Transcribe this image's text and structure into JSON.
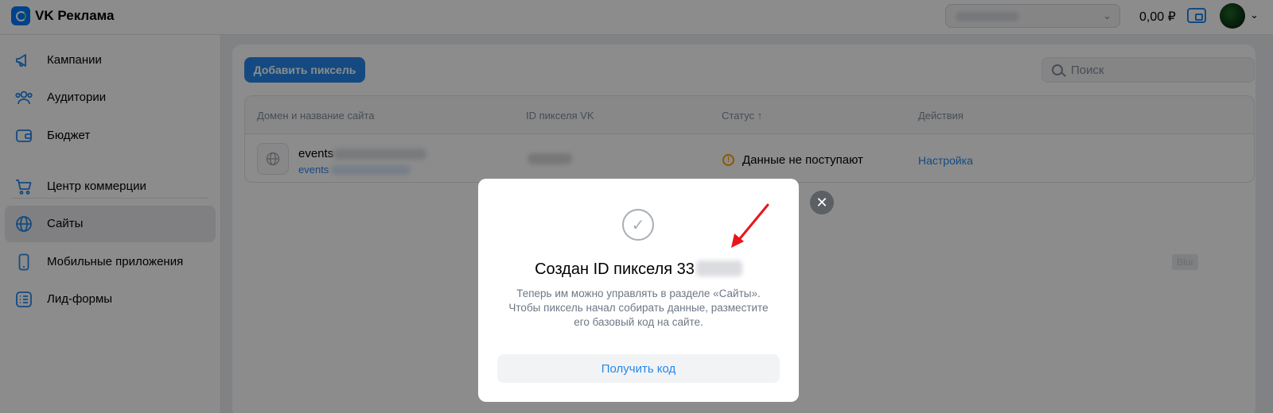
{
  "header": {
    "app_title": "VK Реклама",
    "balance": "0,00 ₽"
  },
  "sidebar": {
    "items": [
      {
        "label": "Кампании",
        "icon": "megaphone-icon"
      },
      {
        "label": "Аудитории",
        "icon": "users-icon"
      },
      {
        "label": "Бюджет",
        "icon": "wallet-icon"
      },
      {
        "label": "Центр коммерции",
        "icon": "cart-icon"
      },
      {
        "label": "Сайты",
        "icon": "globe-icon",
        "active": true
      },
      {
        "label": "Мобильные приложения",
        "icon": "phone-icon"
      },
      {
        "label": "Лид-формы",
        "icon": "list-icon"
      }
    ]
  },
  "main": {
    "add_button": "Добавить пиксель",
    "search_placeholder": "Поиск",
    "columns": [
      "Домен и название сайта",
      "ID пикселя VK",
      "Статус ↑",
      "Действия"
    ],
    "rows": [
      {
        "site_name": "events",
        "domain": "events",
        "status": "Данные не поступают",
        "action": "Настройка"
      }
    ],
    "blur_tag": "Blur"
  },
  "modal": {
    "title": "Создан ID пикселя 33",
    "description": "Теперь им можно управлять в разделе «Сайты». Чтобы пиксель начал собирать данные, разместите его базовый код на сайте.",
    "button": "Получить код"
  },
  "colors": {
    "accent": "#2688eb",
    "warning": "#ff9e00",
    "annotation_arrow": "#e8161b"
  }
}
